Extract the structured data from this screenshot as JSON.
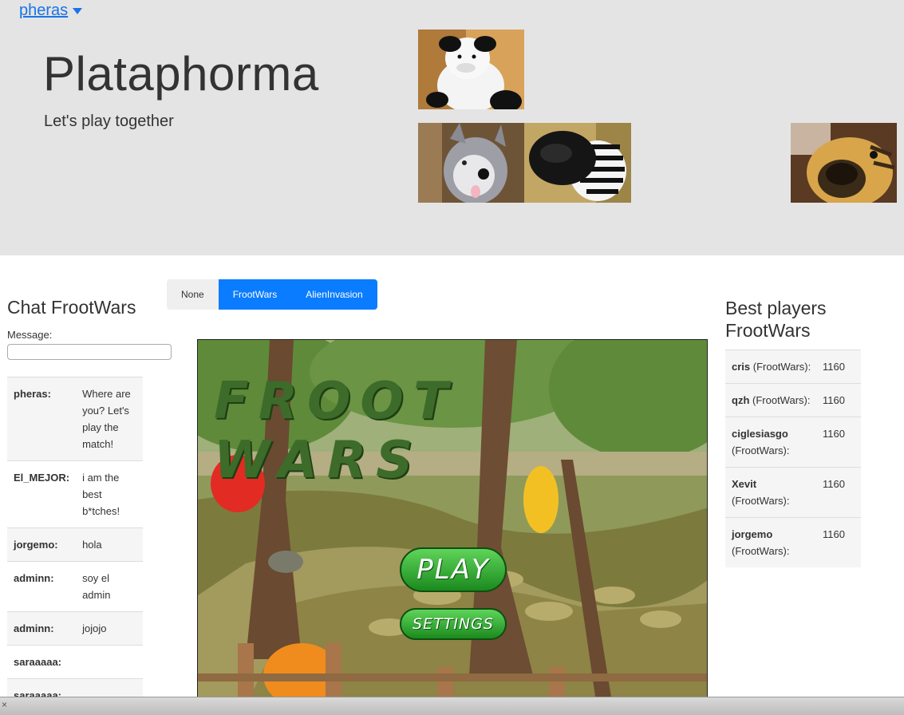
{
  "header": {
    "username": "pheras",
    "title": "Plataphorma",
    "tagline": "Let's play together"
  },
  "tabs": [
    {
      "label": "None",
      "active": false
    },
    {
      "label": "FrootWars",
      "active": true
    },
    {
      "label": "AlienInvasion",
      "active": true
    }
  ],
  "chat": {
    "title": "Chat FrootWars",
    "message_label": "Message:",
    "message_value": "",
    "messages": [
      {
        "user": "pheras:",
        "text": "Where are you? Let's play the match!"
      },
      {
        "user": "El_MEJOR:",
        "text": "i am the best b*tches!"
      },
      {
        "user": "jorgemo:",
        "text": "hola"
      },
      {
        "user": "adminn:",
        "text": "soy el admin"
      },
      {
        "user": "adminn:",
        "text": "jojojo"
      },
      {
        "user": "saraaaaa:",
        "text": ""
      },
      {
        "user": "saraaaaa:",
        "text": ""
      }
    ]
  },
  "game": {
    "logo": "FROOT WARS",
    "play_label": "PLAY",
    "settings_label": "SETTINGS"
  },
  "best": {
    "title": "Best players FrootWars",
    "players": [
      {
        "name": "cris",
        "game": "(FrootWars):",
        "score": "1160"
      },
      {
        "name": "qzh",
        "game": "(FrootWars):",
        "score": "1160"
      },
      {
        "name": "ciglesiasgo",
        "game": "(FrootWars):",
        "score": "1160"
      },
      {
        "name": "Xevit",
        "game": "(FrootWars):",
        "score": "1160"
      },
      {
        "name": "jorgemo",
        "game": "(FrootWars):",
        "score": "1160"
      }
    ]
  },
  "colors": {
    "accent": "#0a7cff",
    "header_bg": "#e4e4e4",
    "link": "#1a73e8"
  },
  "icons": {
    "user_menu": "caret-down-icon",
    "bottom_close": "close-icon"
  }
}
